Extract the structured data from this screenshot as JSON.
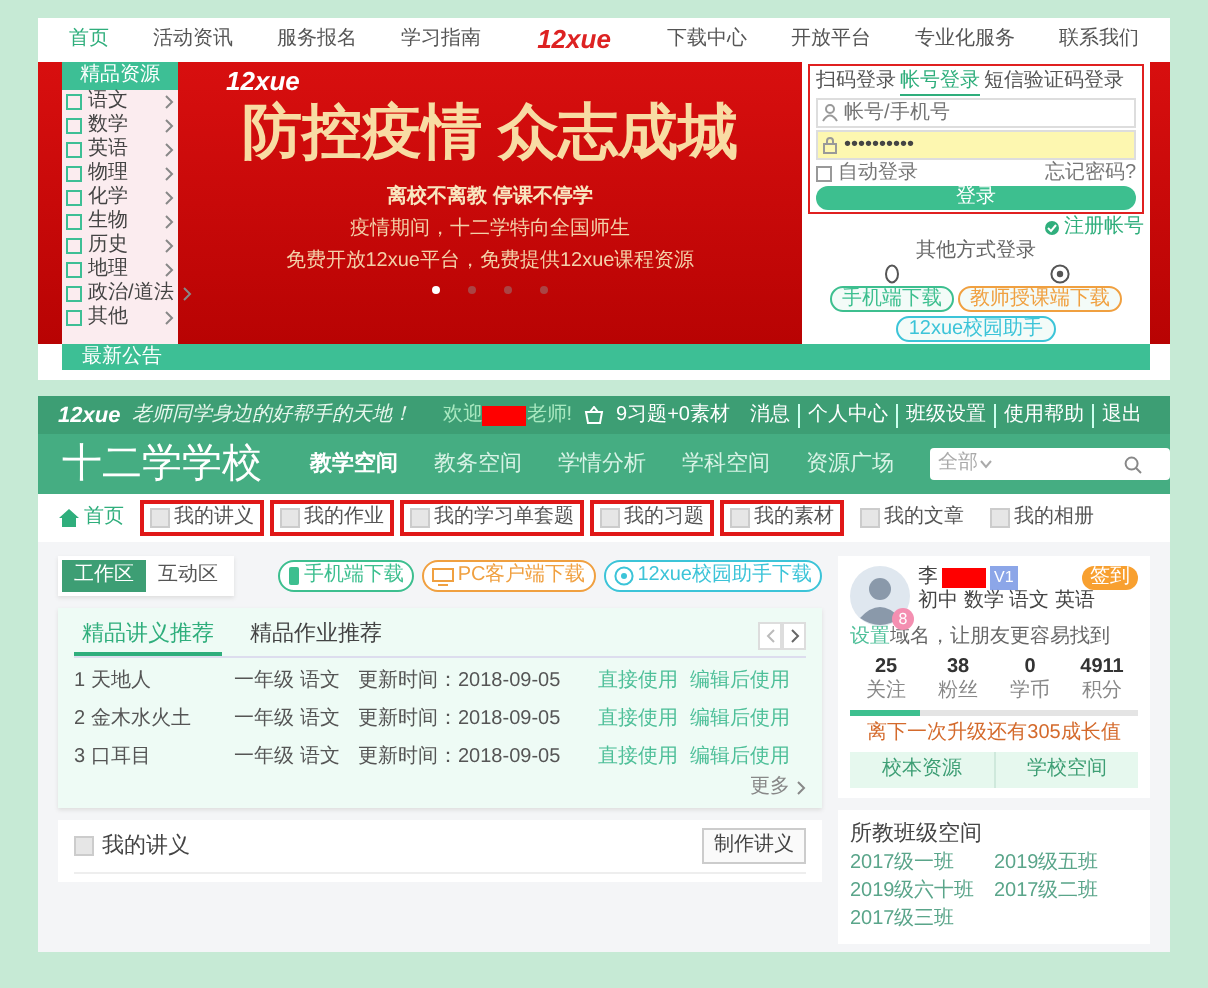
{
  "top_site": {
    "nav_left": [
      {
        "label": "首页",
        "selected": true
      },
      {
        "label": "活动资讯",
        "selected": false
      },
      {
        "label": "服务报名",
        "selected": false
      },
      {
        "label": "学习指南",
        "selected": false
      }
    ],
    "logo": "12xue",
    "nav_right": [
      {
        "label": "下载中心",
        "selected": false
      },
      {
        "label": "开放平台",
        "selected": false
      },
      {
        "label": "专业化服务",
        "selected": false
      },
      {
        "label": "联系我们",
        "selected": false
      }
    ],
    "sidebar": {
      "title": "精品资源",
      "items": [
        "语文",
        "数学",
        "英语",
        "物理",
        "化学",
        "生物",
        "历史",
        "地理",
        "政治/道法",
        "其他"
      ]
    },
    "banner": {
      "logo": "12xue",
      "title": "防控疫情 众志成城",
      "slogan": "离校不离教 停课不停学",
      "lines": [
        "疫情期间，十二学特向全国师生",
        "免费开放12xue平台，免费提供12xue课程资源"
      ],
      "dots": [
        {
          "selected": true
        },
        {
          "selected": false
        },
        {
          "selected": false
        },
        {
          "selected": false
        }
      ]
    },
    "login": {
      "highlighted": true,
      "tabs": [
        {
          "label": "扫码登录",
          "selected": false
        },
        {
          "label": "帐号登录",
          "selected": true
        },
        {
          "label": "短信验证码登录",
          "selected": false
        }
      ],
      "username": {
        "placeholder": "帐号/手机号"
      },
      "password": {
        "value": "••••••••••"
      },
      "remember": {
        "label": "自动登录",
        "checked": false
      },
      "forgot": "忘记密码?",
      "submit": "登录",
      "register": "注册帐号",
      "other_title": "其他方式登录",
      "downloads": [
        {
          "label": "手机端下载",
          "color": "#3dbf8f"
        },
        {
          "label": "教师授课端下载",
          "color": "#f0a040"
        },
        {
          "label": "12xue校园助手",
          "color": "#3cc4d8"
        }
      ]
    },
    "notice": "最新公告"
  },
  "school_site": {
    "topbar": {
      "logo": "12xue",
      "slogan": "老师同学身边的好帮手的天地！",
      "greeting": {
        "prefix": "欢迎",
        "suffix": "老师!",
        "redacted": true
      },
      "basket": "9习题+0素材",
      "links": [
        "消息",
        "个人中心",
        "班级设置",
        "使用帮助",
        "退出"
      ]
    },
    "school_name": "十二学学校",
    "nav": [
      {
        "label": "教学空间",
        "selected": true
      },
      {
        "label": "教务空间",
        "selected": false
      },
      {
        "label": "学情分析",
        "selected": false
      },
      {
        "label": "学科空间",
        "selected": false
      },
      {
        "label": "资源广场",
        "selected": false
      }
    ],
    "search": {
      "scope": "全部"
    },
    "subnav": [
      {
        "label": "首页",
        "kind": "home",
        "selected": true,
        "highlighted": false
      },
      {
        "label": "我的讲义",
        "kind": "page",
        "selected": false,
        "highlighted": true
      },
      {
        "label": "我的作业",
        "kind": "page",
        "selected": false,
        "highlighted": true
      },
      {
        "label": "我的学习单套题",
        "kind": "page",
        "selected": false,
        "highlighted": true
      },
      {
        "label": "我的习题",
        "kind": "page",
        "selected": false,
        "highlighted": true
      },
      {
        "label": "我的素材",
        "kind": "page",
        "selected": false,
        "highlighted": true
      },
      {
        "label": "我的文章",
        "kind": "page",
        "selected": false,
        "highlighted": false
      },
      {
        "label": "我的相册",
        "kind": "page",
        "selected": false,
        "highlighted": false
      }
    ],
    "workspace_tabs": [
      {
        "label": "工作区",
        "selected": true
      },
      {
        "label": "互动区",
        "selected": false
      }
    ],
    "downloads": [
      {
        "label": "手机端下载",
        "kind": "phone",
        "color": "#3dbf8f"
      },
      {
        "label": "PC客户端下载",
        "kind": "monitor",
        "color": "#f0a040"
      },
      {
        "label": "12xue校园助手下载",
        "kind": "assistant",
        "color": "#3cc4d8"
      }
    ],
    "recommend": {
      "tabs": [
        {
          "label": "精品讲义推荐",
          "selected": true
        },
        {
          "label": "精品作业推荐",
          "selected": false
        }
      ],
      "rows": [
        {
          "title": "1 天地人",
          "grade": "一年级",
          "subject": "语文",
          "updated": "更新时间：2018-09-05",
          "use": "直接使用",
          "edit": "编辑后使用"
        },
        {
          "title": "2 金木水火土",
          "grade": "一年级",
          "subject": "语文",
          "updated": "更新时间：2018-09-05",
          "use": "直接使用",
          "edit": "编辑后使用"
        },
        {
          "title": "3 口耳目",
          "grade": "一年级",
          "subject": "语文",
          "updated": "更新时间：2018-09-05",
          "use": "直接使用",
          "edit": "编辑后使用"
        }
      ],
      "more": "更多"
    },
    "my_notes": {
      "title": "我的讲义",
      "action": "制作讲义"
    },
    "profile": {
      "name": "李",
      "redacted": true,
      "vip": "V1",
      "badge": "8",
      "checkin": "签到",
      "subjects": "初中 数学 语文 英语",
      "domain_hint": "设置",
      "domain_text": "域名，让朋友更容易找到",
      "stats": [
        {
          "value": "25",
          "label": "关注"
        },
        {
          "value": "38",
          "label": "粉丝"
        },
        {
          "value": "0",
          "label": "学币"
        },
        {
          "value": "4911",
          "label": "积分"
        }
      ],
      "level": 0.24,
      "progress_text": "离下一次升级还有305成长值",
      "buttons": [
        "校本资源",
        "学校空间"
      ]
    },
    "classes": {
      "title": "所教班级空间",
      "items": [
        "2017级一班",
        "2019级五班",
        "2019级六十班",
        "2017级二班",
        "2017级三班"
      ]
    }
  }
}
